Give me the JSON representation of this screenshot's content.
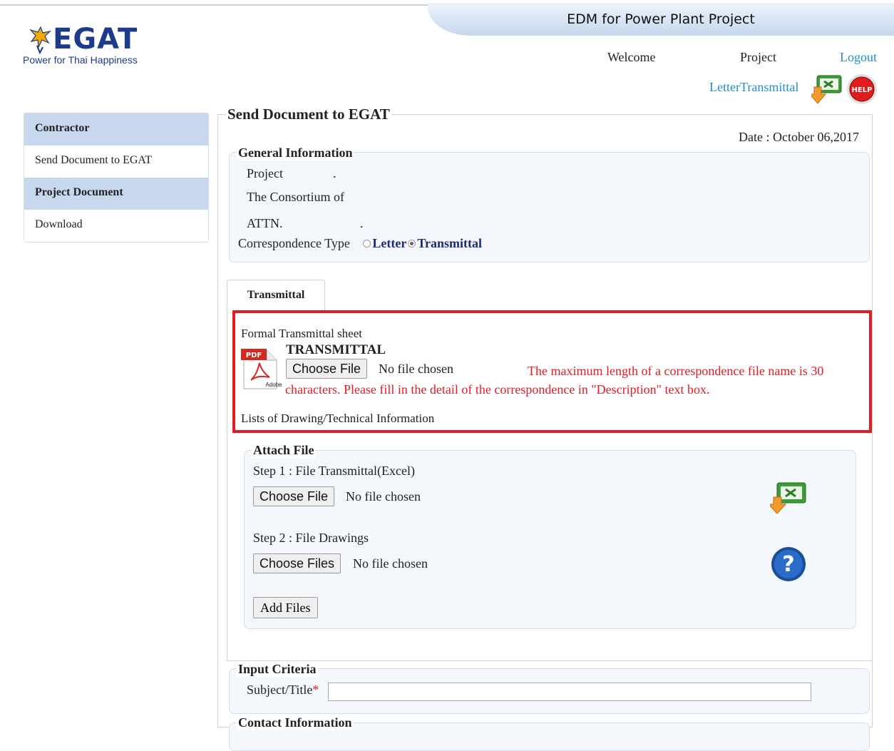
{
  "header": {
    "title": "EDM for Power Plant Project",
    "logo_text": "EGAT",
    "logo_tagline": "Power for Thai Happiness",
    "welcome": "Welcome",
    "project": "Project",
    "logout": "Logout",
    "letter_transmittal": "LetterTransmittal",
    "help_icon_text": "HELP"
  },
  "sidebar": {
    "items": [
      {
        "label": "Contractor",
        "type": "header"
      },
      {
        "label": "Send Document to EGAT",
        "type": "item"
      },
      {
        "label": "Project Document",
        "type": "header"
      },
      {
        "label": "Download",
        "type": "item"
      }
    ]
  },
  "main": {
    "title": "Send Document to EGAT",
    "date": "Date : October 06,2017",
    "general_info": {
      "legend": "General Information",
      "project_label": "Project",
      "project_value": ".",
      "consortium_label": "The Consortium of",
      "attn_label": "ATTN.",
      "attn_value": ".",
      "correspondence_label": "Correspondence Type",
      "options": [
        {
          "label": "Letter",
          "selected": false
        },
        {
          "label": "Transmittal",
          "selected": true
        }
      ]
    },
    "tab_label": "Transmittal",
    "formal_sheet": {
      "label": "Formal Transmittal sheet",
      "heading": "TRANSMITTAL",
      "pdf_badge": "PDF",
      "pdf_vendor": "Adobe",
      "button": "Choose File",
      "status": "No file chosen",
      "warning": "The maximum length of a correspondence file name is 30 characters. Please fill in the detail of the correspondence in \"Description\" text box."
    },
    "lists_label": "Lists of Drawing/Technical Information",
    "attach": {
      "legend": "Attach File",
      "step1_label": "Step 1 : File Transmittal(Excel)",
      "step1_button": "Choose File",
      "step1_status": "No file chosen",
      "step2_label": "Step 2 : File Drawings",
      "step2_button": "Choose Files",
      "step2_status": "No file chosen",
      "add_button": "Add Files"
    },
    "input_criteria": {
      "legend": "Input Criteria",
      "subject_label": "Subject/Title",
      "required_mark": "*",
      "subject_value": ""
    },
    "contact_legend": "Contact Information"
  },
  "colors": {
    "accent_blue": "#1f8fd0",
    "sidebar_header": "#c7d8ee",
    "warning_red": "#e21b23",
    "radio_label": "#1c2a7a"
  }
}
